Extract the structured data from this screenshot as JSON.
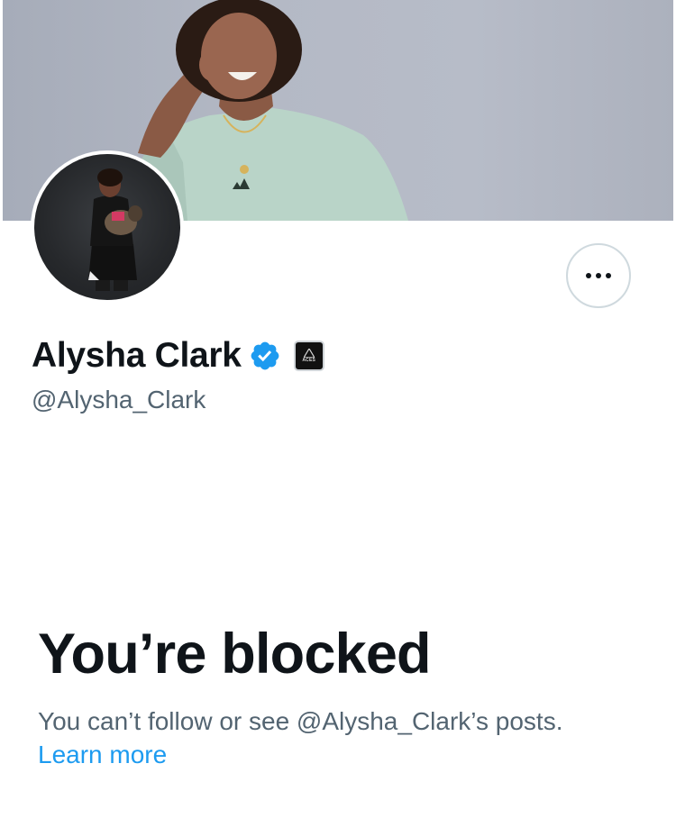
{
  "profile": {
    "display_name": "Alysha Clark",
    "handle": "@Alysha_Clark",
    "affiliation_badge_text": "ACES"
  },
  "blocked": {
    "title": "You’re blocked",
    "message": "You can’t follow or see @Alysha_Clark’s posts.",
    "learn_more": "Learn more"
  },
  "colors": {
    "verified": "#1d9bf0",
    "link": "#1d9bf0",
    "secondary_text": "#536471",
    "primary_text": "#0f1419"
  },
  "icons": {
    "more": "more-horizontal-icon",
    "verified": "verified-badge-icon",
    "affiliation": "aces-logo-icon"
  }
}
